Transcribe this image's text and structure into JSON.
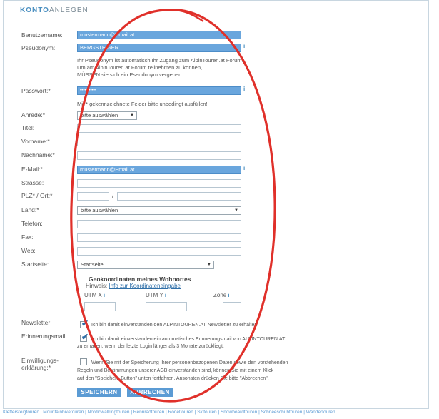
{
  "header": {
    "title_bold": "KONTO",
    "title_rest": "ANLEGEN"
  },
  "labels": {
    "username": "Benutzername:",
    "pseudonym": "Pseudonym:",
    "password": "Passwort:*",
    "salutation": "Anrede:*",
    "title": "Titel:",
    "firstname": "Vorname:*",
    "lastname": "Nachname:*",
    "email": "E-Mail:*",
    "street": "Strasse:",
    "zip": "PLZ* / Ort:*",
    "country": "Land:*",
    "phone": "Telefon:",
    "fax": "Fax:",
    "web": "Web:",
    "startpage": "Startseite:",
    "newsletter": "Newsletter",
    "reminder": "Erinnerungsmail",
    "consent_l1": "Einwilligungs-",
    "consent_l2": "erklärung:*"
  },
  "values": {
    "username": "mustermann@Email.at",
    "pseudonym": "BERGSTEIGER",
    "password": "•••••••••••",
    "email": "mustermann@Email.at",
    "zip_sep": "/"
  },
  "selects": {
    "salutation": "bitte auswählen",
    "country": "bitte auswählen",
    "startpage": "Startseite"
  },
  "notes": {
    "pseudo_l1": "Ihr Pseudonym ist automatisch Ihr Zugang zum AlpinTouren.at Forum.",
    "pseudo_l2": "Um am AlpinTouren.at Forum teilnehmen zu können,",
    "pseudo_l3": "MÜSSEN sie sich ein Pseudonym vergeben.",
    "required": "Mit * gekennzeichnete Felder bitte unbedingt ausfüllen!",
    "newsletter": "Ich bin damit einverstanden den ALPINTOUREN.AT Newsletter zu erhalten.",
    "reminder_l1": "Ich bin damit einverstanden ein automatisches Erinnerungsmail von ALPINTOUREN.AT",
    "reminder_l2": "zu erhalten, wenn der letzte Login länger als 3 Monate zurückliegt.",
    "consent_l1": "Wenn Sie mit der Speicherung Ihrer personenbezogenen Daten sowie den vorstehenden",
    "consent_l2": "Regeln und Bestimmungen unserer AGB einverstanden sind, können Sie mit einem Klick",
    "consent_l3": "auf den \"Speichern Button\" unten fortfahren. Ansonsten drücken Sie bitte \"Abbrechen\"."
  },
  "geo": {
    "title": "Geokoordinaten meines Wohnortes",
    "hint_prefix": "Hinweis: ",
    "hint_link": "Info zur Koordinateneingabe",
    "utm_x": "UTM X",
    "utm_y": "UTM Y",
    "zone": "Zone"
  },
  "buttons": {
    "save": "SPEICHERN",
    "cancel": "ABBRECHEN"
  },
  "info_glyph": "i",
  "checkmark": "✔",
  "footer": "Klettersteigtouren | Mountainbiketouren | Nordicwalkingtouren | Rennradtouren | Rodeltouren | Skitouren | Snowboardtouren | Schneeschuhtouren | Wandertouren",
  "colors": {
    "accent": "#4a8fc0",
    "filled_field": "#6aa6dd",
    "annotation_circle": "#e0302a"
  }
}
